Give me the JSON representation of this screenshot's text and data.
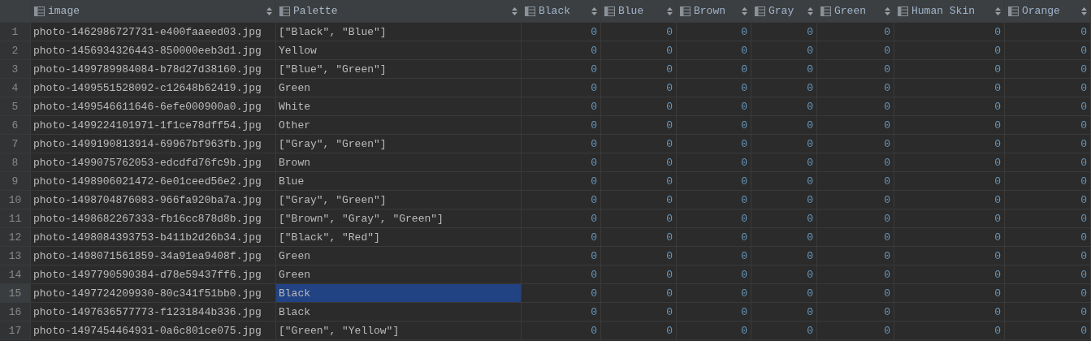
{
  "columns": [
    {
      "label": "image",
      "kind": "text"
    },
    {
      "label": "Palette",
      "kind": "text"
    },
    {
      "label": "Black",
      "kind": "number"
    },
    {
      "label": "Blue",
      "kind": "number"
    },
    {
      "label": "Brown",
      "kind": "number"
    },
    {
      "label": "Gray",
      "kind": "number"
    },
    {
      "label": "Green",
      "kind": "number"
    },
    {
      "label": "Human Skin",
      "kind": "number"
    },
    {
      "label": "Orange",
      "kind": "number"
    }
  ],
  "rows": [
    {
      "number": "1",
      "image": "photo-1462986727731-e400faaeed03.jpg",
      "palette": {
        "text": "[\"Black\", \"Blue\"]",
        "selected": false
      },
      "values": [
        "0",
        "0",
        "0",
        "0",
        "0",
        "0",
        "0"
      ]
    },
    {
      "number": "2",
      "image": "photo-1456934326443-850000eeb3d1.jpg",
      "palette": {
        "text": "Yellow",
        "selected": false
      },
      "values": [
        "0",
        "0",
        "0",
        "0",
        "0",
        "0",
        "0"
      ]
    },
    {
      "number": "3",
      "image": "photo-1499789984084-b78d27d38160.jpg",
      "palette": {
        "text": "[\"Blue\", \"Green\"]",
        "selected": false
      },
      "values": [
        "0",
        "0",
        "0",
        "0",
        "0",
        "0",
        "0"
      ]
    },
    {
      "number": "4",
      "image": "photo-1499551528092-c12648b62419.jpg",
      "palette": {
        "text": "Green",
        "selected": false
      },
      "values": [
        "0",
        "0",
        "0",
        "0",
        "0",
        "0",
        "0"
      ]
    },
    {
      "number": "5",
      "image": "photo-1499546611646-6efe000900a0.jpg",
      "palette": {
        "text": "White",
        "selected": false
      },
      "values": [
        "0",
        "0",
        "0",
        "0",
        "0",
        "0",
        "0"
      ]
    },
    {
      "number": "6",
      "image": "photo-1499224101971-1f1ce78dff54.jpg",
      "palette": {
        "text": "Other",
        "selected": false
      },
      "values": [
        "0",
        "0",
        "0",
        "0",
        "0",
        "0",
        "0"
      ]
    },
    {
      "number": "7",
      "image": "photo-1499190813914-69967bf963fb.jpg",
      "palette": {
        "text": "[\"Gray\", \"Green\"]",
        "selected": false
      },
      "values": [
        "0",
        "0",
        "0",
        "0",
        "0",
        "0",
        "0"
      ]
    },
    {
      "number": "8",
      "image": "photo-1499075762053-edcdfd76fc9b.jpg",
      "palette": {
        "text": "Brown",
        "selected": false
      },
      "values": [
        "0",
        "0",
        "0",
        "0",
        "0",
        "0",
        "0"
      ]
    },
    {
      "number": "9",
      "image": "photo-1498906021472-6e01ceed56e2.jpg",
      "palette": {
        "text": "Blue",
        "selected": false
      },
      "values": [
        "0",
        "0",
        "0",
        "0",
        "0",
        "0",
        "0"
      ]
    },
    {
      "number": "10",
      "image": "photo-1498704876083-966fa920ba7a.jpg",
      "palette": {
        "text": "[\"Gray\", \"Green\"]",
        "selected": false
      },
      "values": [
        "0",
        "0",
        "0",
        "0",
        "0",
        "0",
        "0"
      ]
    },
    {
      "number": "11",
      "image": "photo-1498682267333-fb16cc878d8b.jpg",
      "palette": {
        "text": "[\"Brown\", \"Gray\", \"Green\"]",
        "selected": false
      },
      "values": [
        "0",
        "0",
        "0",
        "0",
        "0",
        "0",
        "0"
      ]
    },
    {
      "number": "12",
      "image": "photo-1498084393753-b411b2d26b34.jpg",
      "palette": {
        "text": "[\"Black\", \"Red\"]",
        "selected": false
      },
      "values": [
        "0",
        "0",
        "0",
        "0",
        "0",
        "0",
        "0"
      ]
    },
    {
      "number": "13",
      "image": "photo-1498071561859-34a91ea9408f.jpg",
      "palette": {
        "text": "Green",
        "selected": false
      },
      "values": [
        "0",
        "0",
        "0",
        "0",
        "0",
        "0",
        "0"
      ]
    },
    {
      "number": "14",
      "image": "photo-1497790590384-d78e59437ff6.jpg",
      "palette": {
        "text": "Green",
        "selected": false
      },
      "values": [
        "0",
        "0",
        "0",
        "0",
        "0",
        "0",
        "0"
      ]
    },
    {
      "number": "15",
      "image": "photo-1497724209930-80c341f51bb0.jpg",
      "palette": {
        "text": "Black",
        "selected": true
      },
      "values": [
        "0",
        "0",
        "0",
        "0",
        "0",
        "0",
        "0"
      ]
    },
    {
      "number": "16",
      "image": "photo-1497636577773-f1231844b336.jpg",
      "palette": {
        "text": "Black",
        "selected": false
      },
      "values": [
        "0",
        "0",
        "0",
        "0",
        "0",
        "0",
        "0"
      ]
    },
    {
      "number": "17",
      "image": "photo-1497454464931-0a6c801ce075.jpg",
      "palette": {
        "text": "[\"Green\", \"Yellow\"]",
        "selected": false
      },
      "values": [
        "0",
        "0",
        "0",
        "0",
        "0",
        "0",
        "0"
      ]
    }
  ]
}
